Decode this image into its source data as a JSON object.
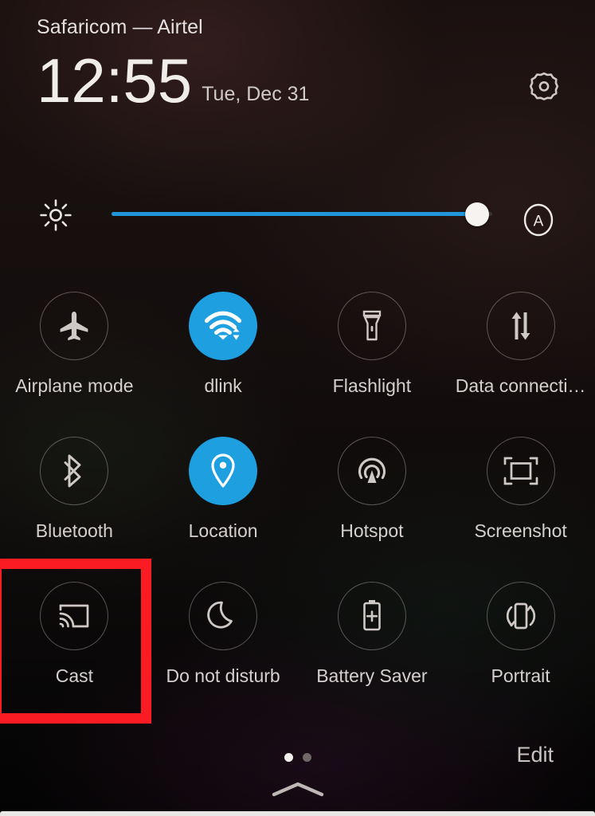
{
  "statusbar": {
    "carrier": "Safaricom — Airtel"
  },
  "header": {
    "time": "12:55",
    "date": "Tue, Dec 31",
    "settings_icon": "gear-icon"
  },
  "brightness": {
    "icon": "brightness-sun-icon",
    "value_percent": 96,
    "auto_label": "A",
    "auto_icon": "auto-brightness-icon",
    "fill_color": "#2196d8",
    "track_color": "#3e3836",
    "thumb_color": "#f6f3f1"
  },
  "tiles": [
    {
      "label": "Airplane mode",
      "icon": "airplane-icon",
      "active": false
    },
    {
      "label": "dlink",
      "icon": "wifi-icon",
      "active": true
    },
    {
      "label": "Flashlight",
      "icon": "flashlight-icon",
      "active": false
    },
    {
      "label": "Data connecti…",
      "icon": "data-transfer-icon",
      "active": false
    },
    {
      "label": "Bluetooth",
      "icon": "bluetooth-icon",
      "active": false
    },
    {
      "label": "Location",
      "icon": "location-pin-icon",
      "active": true
    },
    {
      "label": "Hotspot",
      "icon": "hotspot-icon",
      "active": false
    },
    {
      "label": "Screenshot",
      "icon": "screenshot-icon",
      "active": false
    },
    {
      "label": "Cast",
      "icon": "cast-icon",
      "active": false
    },
    {
      "label": "Do not disturb",
      "icon": "moon-icon",
      "active": false
    },
    {
      "label": "Battery Saver",
      "icon": "battery-plus-icon",
      "active": false
    },
    {
      "label": "Portrait",
      "icon": "screen-rotation-icon",
      "active": false
    }
  ],
  "footer": {
    "edit_label": "Edit",
    "page_count": 2,
    "active_page": 1,
    "collapse_icon": "chevron-up-icon"
  },
  "annotation": {
    "target_tile": "Cast",
    "box_color": "#fb1c23"
  },
  "colors": {
    "active_tile": "#1ea0e0",
    "background": "#120b0b",
    "text_primary": "#e4e0df",
    "text_secondary": "#d5d0ce"
  }
}
